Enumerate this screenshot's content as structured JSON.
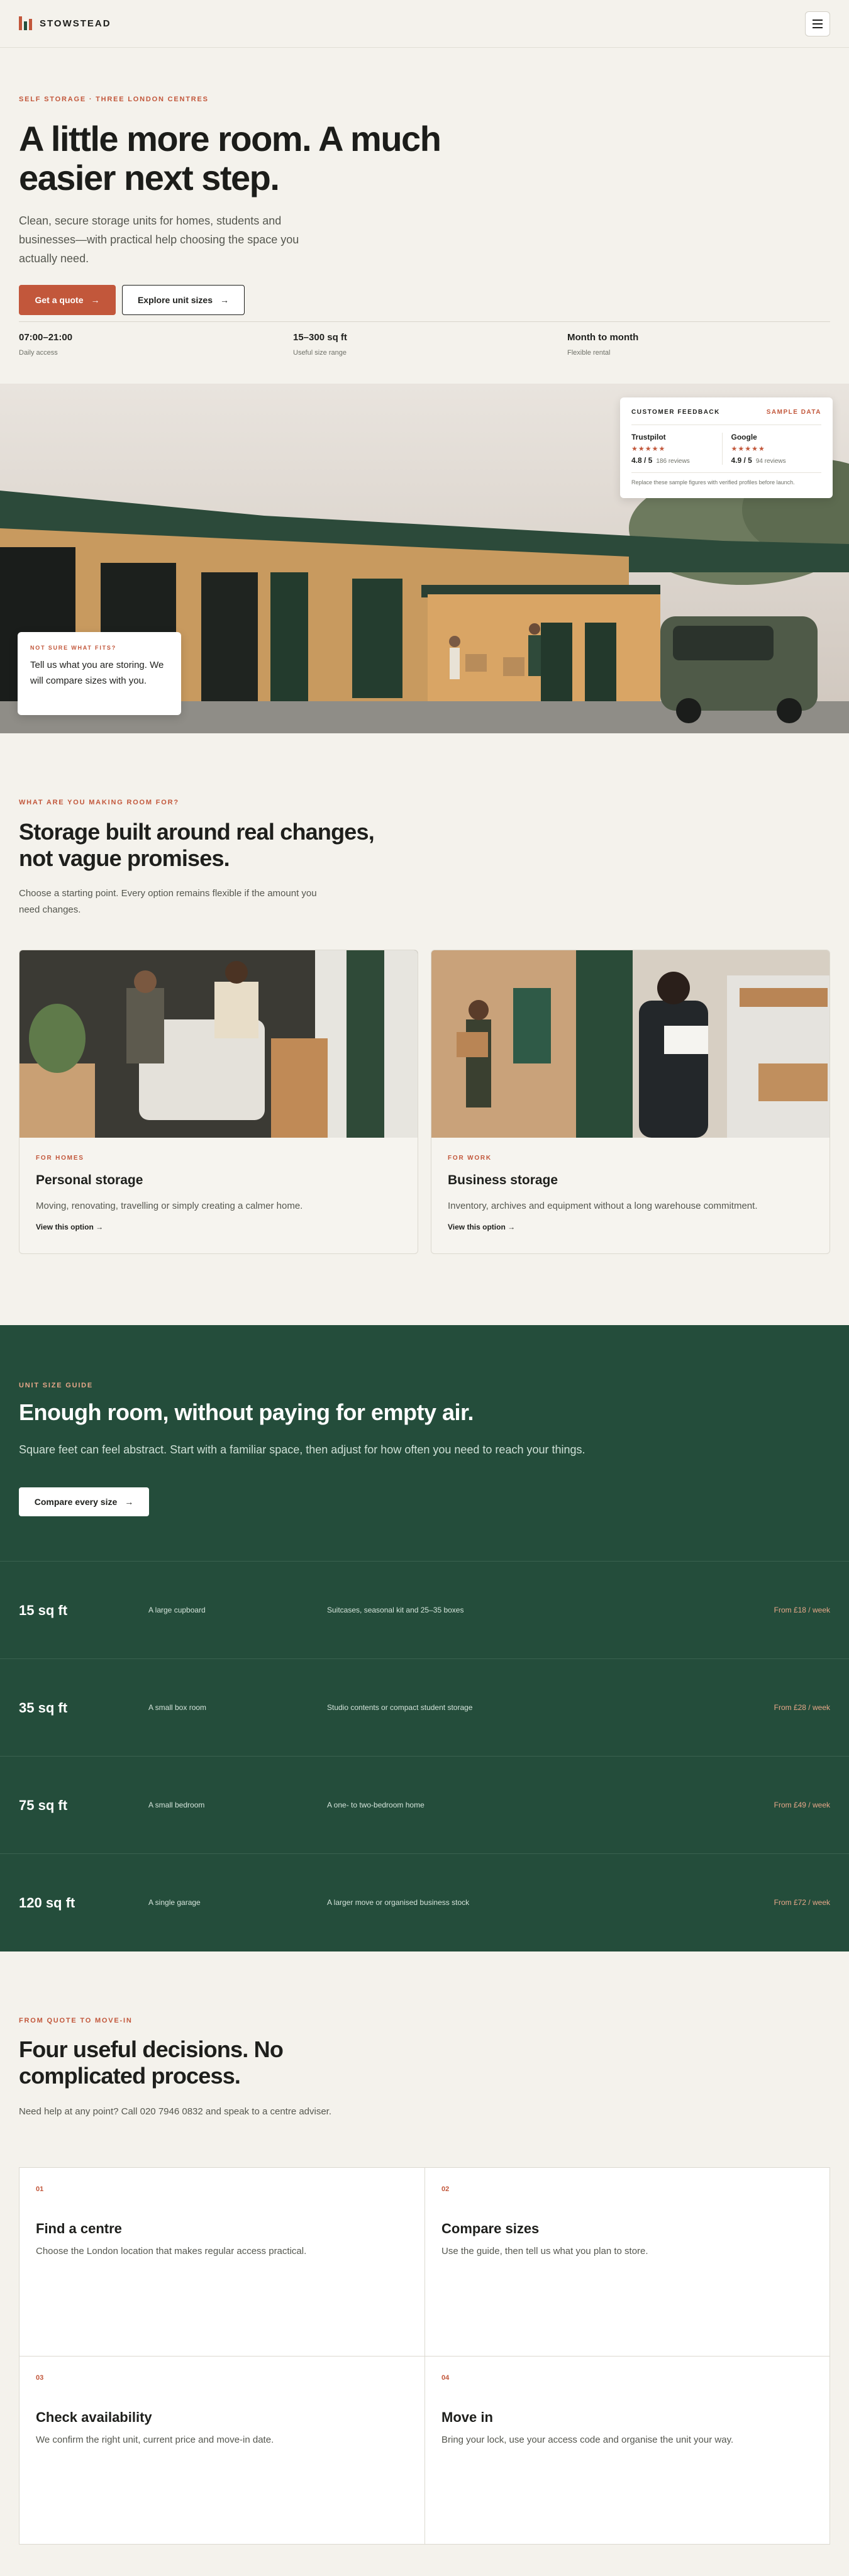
{
  "header": {
    "brand": "STOWSTEAD",
    "menu_icon": "hamburger-menu-icon"
  },
  "hero": {
    "eyebrow": "SELF STORAGE · THREE LONDON CENTRES",
    "title": "A little more room. A much easier next step.",
    "subtitle": "Clean, secure storage units for homes, students and businesses—with practical help choosing the space you actually need.",
    "primary_cta": "Get a quote",
    "secondary_cta": "Explore unit sizes",
    "arrow_icon": "arrow-right-icon",
    "stats": [
      {
        "value": "07:00–21:00",
        "label": "Daily access"
      },
      {
        "value": "15–300 sq ft",
        "label": "Useful size range"
      },
      {
        "value": "Month to month",
        "label": "Flexible rental"
      }
    ]
  },
  "feedback": {
    "title": "CUSTOMER FEEDBACK",
    "tag": "SAMPLE DATA",
    "sources": [
      {
        "name": "Trustpilot",
        "stars": "★★★★★",
        "score": "4.8 / 5",
        "reviews": "186 reviews"
      },
      {
        "name": "Google",
        "stars": "★★★★★",
        "score": "4.9 / 5",
        "reviews": "94 reviews"
      }
    ],
    "note": "Replace these sample figures with verified profiles before launch."
  },
  "help": {
    "eyebrow": "NOT SURE WHAT FITS?",
    "text": "Tell us what you are storing. We will compare sizes with you."
  },
  "needs": {
    "eyebrow": "WHAT ARE YOU MAKING ROOM FOR?",
    "title": "Storage built around real changes, not vague promises.",
    "subtitle": "Choose a starting point. Every option remains flexible if the amount you need changes.",
    "cards": [
      {
        "eyebrow": "FOR HOMES",
        "title": "Personal storage",
        "desc": "Moving, renovating, travelling or simply creating a calmer home.",
        "link": "View this option →"
      },
      {
        "eyebrow": "FOR WORK",
        "title": "Business storage",
        "desc": "Inventory, archives and equipment without a long warehouse commitment.",
        "link": "View this option →"
      }
    ]
  },
  "sizes": {
    "eyebrow": "UNIT SIZE GUIDE",
    "title": "Enough room, without paying for empty air.",
    "subtitle": "Square feet can feel abstract. Start with a familiar space, then adjust for how often you need to reach your things.",
    "cta": "Compare every size",
    "rows": [
      {
        "size": "15 sq ft",
        "compare": "A large cupboard",
        "fits": "Suitcases, seasonal kit and 25–35 boxes",
        "price": "From £18 / week"
      },
      {
        "size": "35 sq ft",
        "compare": "A small box room",
        "fits": "Studio contents or compact student storage",
        "price": "From £28 / week"
      },
      {
        "size": "75 sq ft",
        "compare": "A small bedroom",
        "fits": "A one- to two-bedroom home",
        "price": "From £49 / week"
      },
      {
        "size": "120 sq ft",
        "compare": "A single garage",
        "fits": "A larger move or organised business stock",
        "price": "From £72 / week"
      }
    ]
  },
  "steps": {
    "eyebrow": "FROM QUOTE TO MOVE-IN",
    "title": "Four useful decisions. No complicated process.",
    "subtitle": "Need help at any point? Call 020 7946 0832 and speak to a centre adviser.",
    "items": [
      {
        "num": "01",
        "title": "Find a centre",
        "desc": "Choose the London location that makes regular access practical."
      },
      {
        "num": "02",
        "title": "Compare sizes",
        "desc": "Use the guide, then tell us what you plan to store."
      },
      {
        "num": "03",
        "title": "Check availability",
        "desc": "We confirm the right unit, current price and move-in date."
      },
      {
        "num": "04",
        "title": "Move in",
        "desc": "Bring your lock, use your access code and organise the unit your way."
      }
    ]
  },
  "colors": {
    "accent": "#c2573b",
    "forest": "#244d3b",
    "background": "#f4f2ec"
  }
}
